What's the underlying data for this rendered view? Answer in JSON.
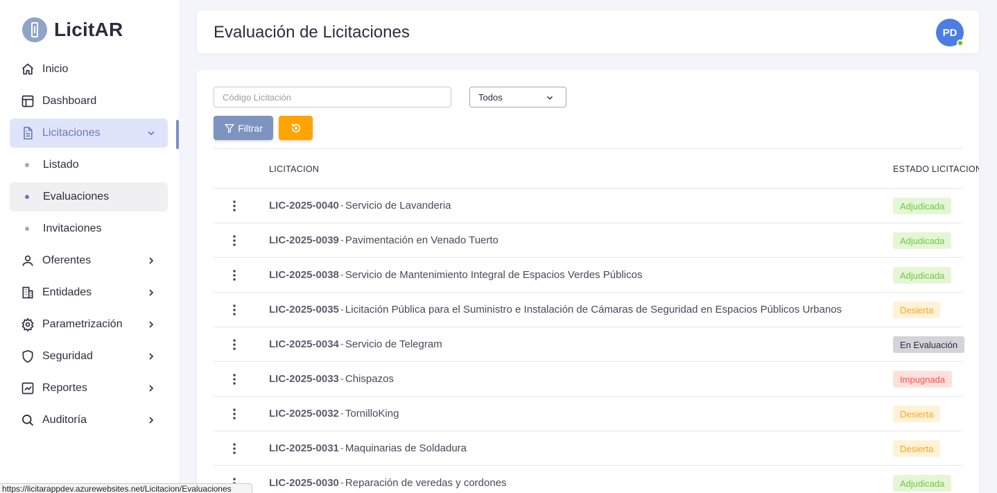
{
  "brand": {
    "name": "LicitAR"
  },
  "sidebar": {
    "items": [
      {
        "label": "Inicio",
        "icon": "home-icon"
      },
      {
        "label": "Dashboard",
        "icon": "layout-icon"
      },
      {
        "label": "Licitaciones",
        "icon": "file-icon",
        "expanded": true
      },
      {
        "label": "Listado"
      },
      {
        "label": "Evaluaciones",
        "active": true
      },
      {
        "label": "Invitaciones"
      },
      {
        "label": "Oferentes",
        "icon": "user-icon"
      },
      {
        "label": "Entidades",
        "icon": "building-icon"
      },
      {
        "label": "Parametrización",
        "icon": "gear-icon"
      },
      {
        "label": "Seguridad",
        "icon": "shield-icon"
      },
      {
        "label": "Reportes",
        "icon": "chart-icon"
      },
      {
        "label": "Auditoría",
        "icon": "search-icon"
      }
    ]
  },
  "header": {
    "title": "Evaluación de Licitaciones",
    "avatar_initials": "PD"
  },
  "filters": {
    "search_placeholder": "Código Licitación",
    "select_value": "Todos",
    "filter_label": "Filtrar"
  },
  "table": {
    "headers": [
      "LICITACION",
      "ESTADO LICITACION"
    ],
    "rows": [
      {
        "code": "LIC-2025-0040",
        "name": "Servicio de Lavanderia",
        "status": "Adjudicada"
      },
      {
        "code": "LIC-2025-0039",
        "name": "Pavimentación en Venado Tuerto",
        "status": "Adjudicada"
      },
      {
        "code": "LIC-2025-0038",
        "name": "Servicio de Mantenimiento Integral de Espacios Verdes Públicos",
        "status": "Adjudicada"
      },
      {
        "code": "LIC-2025-0035",
        "name": "Licitación Pública para el Suministro e Instalación de Cámaras de Seguridad en Espacios Públicos Urbanos",
        "status": "Desierta"
      },
      {
        "code": "LIC-2025-0034",
        "name": "Servicio de Telegram",
        "status": "En Evaluación"
      },
      {
        "code": "LIC-2025-0033",
        "name": "Chispazos",
        "status": "Impugnada"
      },
      {
        "code": "LIC-2025-0032",
        "name": "TornilloKing",
        "status": "Desierta"
      },
      {
        "code": "LIC-2025-0031",
        "name": "Maquinarias de Soldadura",
        "status": "Desierta"
      },
      {
        "code": "LIC-2025-0030",
        "name": "Reparación de veredas y cordones",
        "status": "Adjudicada"
      }
    ]
  },
  "status_bar": {
    "url": "https://licitarappdev.azurewebsites.net/Licitacion/Evaluaciones"
  },
  "colors": {
    "accent": "#7d93c0",
    "warning": "#ffa400",
    "success": "#72c841",
    "danger": "#ff4c51"
  }
}
